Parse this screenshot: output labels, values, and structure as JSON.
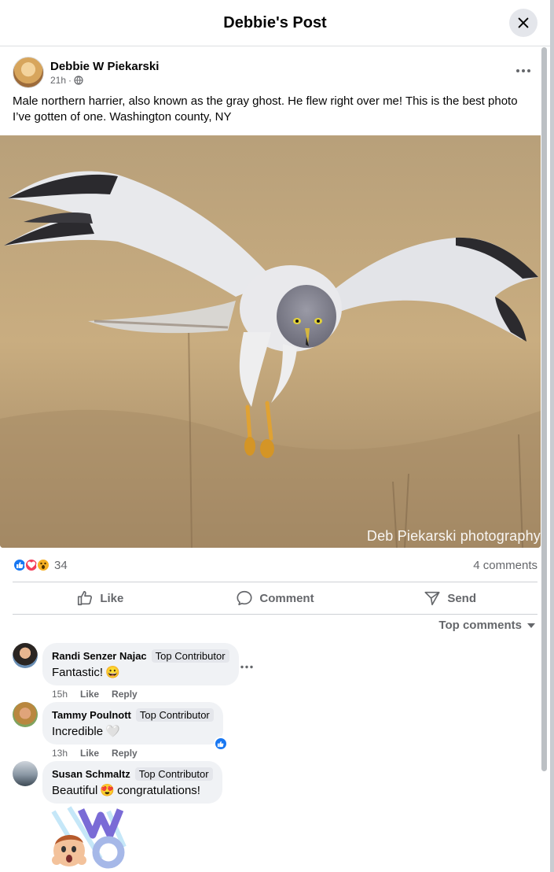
{
  "header": {
    "title": "Debbie's Post"
  },
  "post": {
    "author": "Debbie W Piekarski",
    "time": "21h",
    "separator": "·",
    "text": "Male northern harrier, also known as the gray ghost. He flew right over me! This is the best photo I’ve gotten of one. Washington county, NY",
    "photo_watermark": "Deb Piekarski photography"
  },
  "reactions": {
    "count": "34",
    "types": [
      "like",
      "love",
      "wow"
    ],
    "comments_label": "4 comments"
  },
  "actions": {
    "like": "Like",
    "comment": "Comment",
    "send": "Send"
  },
  "sort": {
    "label": "Top comments"
  },
  "comments": [
    {
      "name": "Randi Senzer Najac",
      "badge": "Top Contributor",
      "text": "Fantastic!",
      "emoji": "😀",
      "time": "15h",
      "like": "Like",
      "reply": "Reply"
    },
    {
      "name": "Tammy Poulnott",
      "badge": "Top Contributor",
      "text": "Incredible",
      "emoji": "🤍",
      "time": "13h",
      "like": "Like",
      "reply": "Reply"
    },
    {
      "name": "Susan Schmaltz",
      "badge": "Top Contributor",
      "text_before": "Beautiful",
      "emoji": "😍",
      "text_after": "congratulations!"
    }
  ],
  "colors": {
    "accent": "#1877f2",
    "love": "#f33e58",
    "wow": "#f7b125",
    "bubble": "#f0f2f5",
    "secondary_text": "#65676b"
  }
}
